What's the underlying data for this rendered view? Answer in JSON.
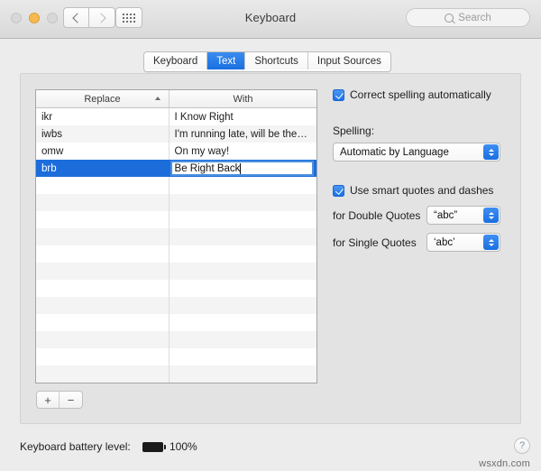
{
  "window": {
    "title": "Keyboard",
    "traffic_lights": [
      "close-button",
      "minimize-button",
      "zoom-button"
    ],
    "back_label": "",
    "forward_label": "",
    "grid_label": "",
    "accent_blue": "#1c6ddb",
    "minimize_yellow": "#f6ba51"
  },
  "search": {
    "placeholder": "Search",
    "value": "",
    "icon": "search-icon"
  },
  "tabs": [
    {
      "label": "Keyboard",
      "active": false
    },
    {
      "label": "Text",
      "active": true
    },
    {
      "label": "Shortcuts",
      "active": false
    },
    {
      "label": "Input Sources",
      "active": false
    }
  ],
  "table": {
    "columns": [
      {
        "label": "Replace",
        "sort": "ascending",
        "sort_icon": "sort-ascending-icon"
      },
      {
        "label": "With",
        "sort": "none"
      }
    ],
    "rows": [
      {
        "replace": "ikr",
        "with": "I Know Right",
        "selected": false,
        "editing": false
      },
      {
        "replace": "iwbs",
        "with": "I'm running late, will be the…",
        "selected": false,
        "editing": false
      },
      {
        "replace": "omw",
        "with": "On my way!",
        "selected": false,
        "editing": false
      },
      {
        "replace": "brb",
        "with": "Be Right Back",
        "selected": true,
        "editing": true
      }
    ],
    "empty_row_count": 17
  },
  "table_buttons": {
    "add_label": "+",
    "remove_label": "−"
  },
  "settings": {
    "correct_spelling": {
      "label": "Correct spelling automatically",
      "checked": true
    },
    "spelling": {
      "label": "Spelling:",
      "selected": "Automatic by Language"
    },
    "smart_quotes": {
      "label": "Use smart quotes and dashes",
      "checked": true
    },
    "double_quotes": {
      "label": "for Double Quotes",
      "selected": "“abc”"
    },
    "single_quotes": {
      "label": "for Single Quotes",
      "selected": "‘abc’"
    }
  },
  "footer": {
    "battery_label": "Keyboard battery level:",
    "battery_icon": "battery-full-icon",
    "battery_percent": "100%",
    "help_label": "?",
    "watermark": "wsxdn.com"
  }
}
